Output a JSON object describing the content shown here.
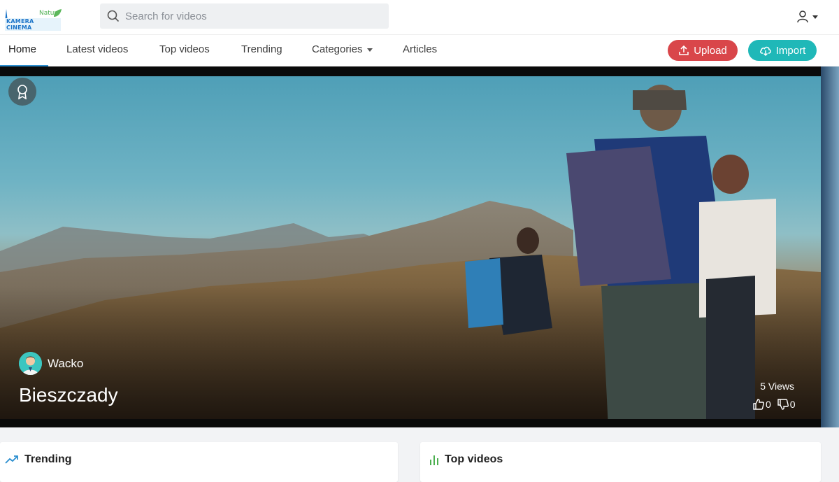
{
  "logo": {
    "top": "Natur",
    "main": "KAMERA CINEMA"
  },
  "search": {
    "placeholder": "Search for videos"
  },
  "nav": {
    "items": [
      {
        "label": "Home"
      },
      {
        "label": "Latest videos"
      },
      {
        "label": "Top videos"
      },
      {
        "label": "Trending"
      },
      {
        "label": "Categories"
      },
      {
        "label": "Articles"
      }
    ],
    "upload_label": "Upload",
    "import_label": "Import"
  },
  "hero": {
    "channel": "Wacko",
    "title": "Bieszczady",
    "views": "5 Views",
    "likes": "0",
    "dislikes": "0"
  },
  "sections": {
    "trending_title": "Trending",
    "top_title": "Top videos"
  },
  "colors": {
    "accent_blue": "#2b8ecf",
    "upload": "#d9464a",
    "import": "#1fb8b8",
    "trending_icon": "#2b8ecf",
    "top_icon": "#4caf50"
  },
  "icons": {
    "search": "search-icon",
    "user": "user-icon",
    "upload": "upload-icon",
    "import": "cloud-download-icon",
    "award": "award-icon",
    "like": "thumbs-up-icon",
    "dislike": "thumbs-down-icon",
    "trending": "trending-up-icon",
    "top": "bar-chart-icon"
  }
}
